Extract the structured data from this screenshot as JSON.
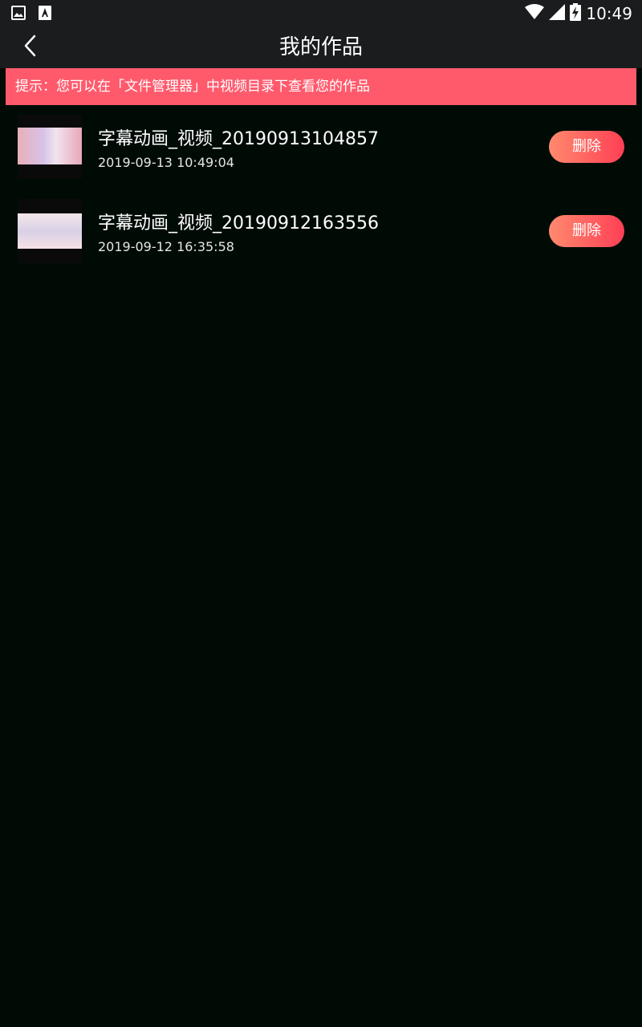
{
  "status_bar": {
    "time": "10:49",
    "left_icons": [
      "gallery-icon",
      "font-app-icon"
    ],
    "right_icons": [
      "wifi-icon",
      "cellular-signal-icon",
      "battery-charging-icon"
    ]
  },
  "nav": {
    "title": "我的作品",
    "back_icon": "chevron-left-icon"
  },
  "tip": {
    "text": "提示：您可以在「文件管理器」中视频目录下查看您的作品",
    "color": "#ff5a6c"
  },
  "works": [
    {
      "title": "字幕动画_视频_20190913104857",
      "time": "2019-09-13 10:49:04",
      "delete_label": "删除"
    },
    {
      "title": "字幕动画_视频_20190912163556",
      "time": "2019-09-12 16:35:58",
      "delete_label": "删除"
    }
  ],
  "colors": {
    "background": "#000b06",
    "bar": "#1b1c1e",
    "accent_start": "#ff8a6e",
    "accent_end": "#ff3f55"
  }
}
